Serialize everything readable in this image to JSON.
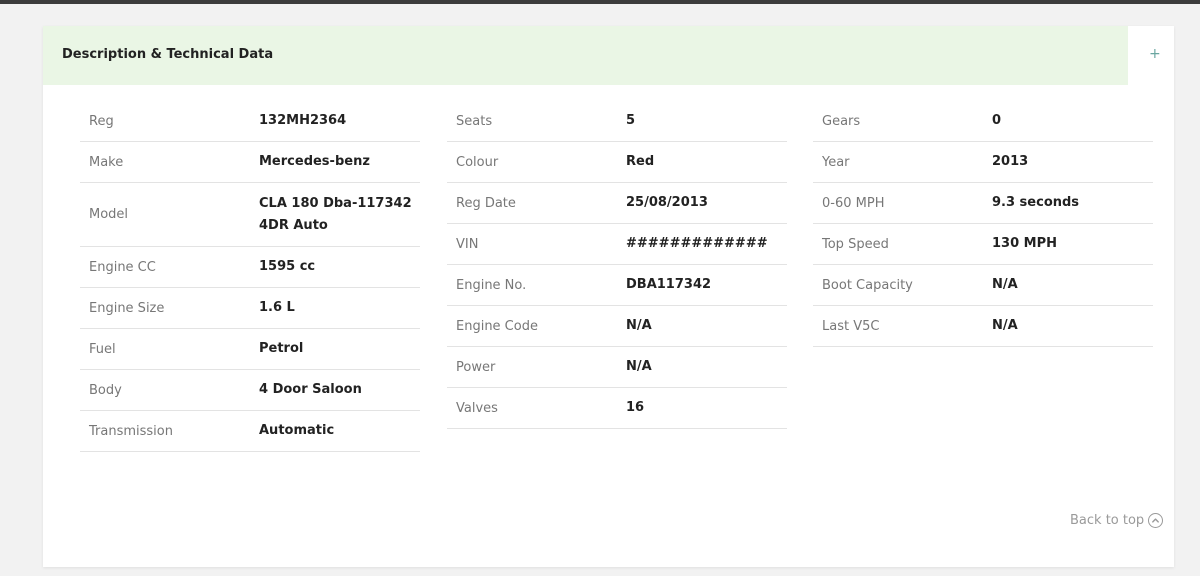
{
  "section": {
    "title": "Description & Technical Data",
    "toggle_icon": "plus-icon",
    "toggle_symbol": "+"
  },
  "columns": [
    [
      {
        "label": "Reg",
        "value": "132MH2364"
      },
      {
        "label": "Make",
        "value": "Mercedes-benz"
      },
      {
        "label": "Model",
        "value": "CLA 180 Dba-117342 4DR Auto"
      },
      {
        "label": "Engine CC",
        "value": "1595 cc"
      },
      {
        "label": "Engine Size",
        "value": "1.6 L"
      },
      {
        "label": "Fuel",
        "value": "Petrol"
      },
      {
        "label": "Body",
        "value": "4 Door Saloon"
      },
      {
        "label": "Transmission",
        "value": "Automatic"
      }
    ],
    [
      {
        "label": "Seats",
        "value": "5"
      },
      {
        "label": "Colour",
        "value": "Red"
      },
      {
        "label": "Reg Date",
        "value": "25/08/2013"
      },
      {
        "label": "VIN",
        "value": "#############"
      },
      {
        "label": "Engine No.",
        "value": "DBA117342"
      },
      {
        "label": "Engine Code",
        "value": "N/A"
      },
      {
        "label": "Power",
        "value": "N/A"
      },
      {
        "label": "Valves",
        "value": "16"
      }
    ],
    [
      {
        "label": "Gears",
        "value": "0"
      },
      {
        "label": "Year",
        "value": "2013"
      },
      {
        "label": "0-60 MPH",
        "value": "9.3 seconds"
      },
      {
        "label": "Top Speed",
        "value": "130 MPH"
      },
      {
        "label": "Boot Capacity",
        "value": "N/A"
      },
      {
        "label": "Last V5C",
        "value": "N/A"
      }
    ]
  ],
  "footer": {
    "back_to_top": "Back to top",
    "back_to_top_icon": "chevron-up-circle-icon"
  },
  "colors": {
    "header_background": "#eaf6e5",
    "toggle_icon": "#6aa6a0"
  }
}
